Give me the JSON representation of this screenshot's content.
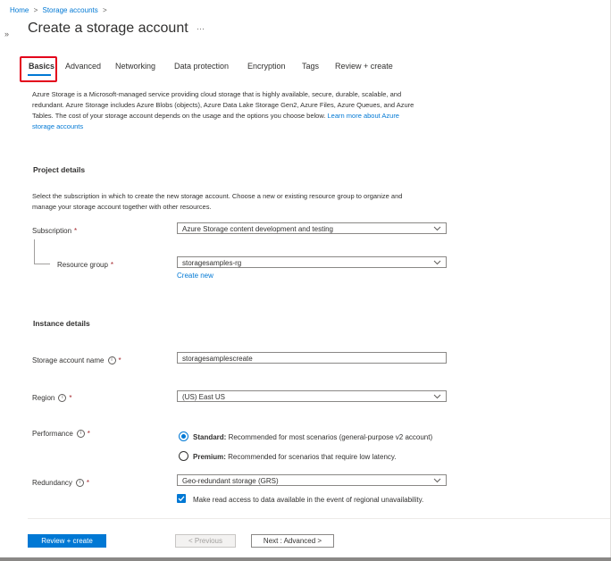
{
  "breadcrumb": {
    "home": "Home",
    "separator": ">",
    "storage_accounts": "Storage accounts",
    "trailing_separator": ">"
  },
  "collapse_glyph": "»",
  "page": {
    "title": "Create a storage account",
    "more": "···"
  },
  "tabs": [
    {
      "label": "Basics",
      "selected": true
    },
    {
      "label": "Advanced"
    },
    {
      "label": "Networking"
    },
    {
      "label": "Data protection"
    },
    {
      "label": "Encryption"
    },
    {
      "label": "Tags"
    },
    {
      "label": "Review + create"
    }
  ],
  "intro": {
    "line1": "Azure Storage is a Microsoft-managed service providing cloud storage that is highly available, secure, durable, scalable, and",
    "line2": "redundant. Azure Storage includes Azure Blobs (objects), Azure Data Lake Storage Gen2, Azure Files, Azure Queues, and Azure",
    "line3": "Tables. The cost of your storage account depends on the usage and the options you choose below.",
    "link_part1": "Learn more about Azure",
    "link_part2": "storage accounts"
  },
  "project": {
    "heading": "Project details",
    "desc_line1": "Select the subscription in which to create the new storage account. Choose a new or existing resource group to organize and",
    "desc_line2": "manage your storage account together with other resources.",
    "subscription_label": "Subscription",
    "subscription_value": "Azure Storage content development and testing",
    "resource_group_label": "Resource group",
    "resource_group_value": "storagesamples-rg",
    "create_new": "Create new"
  },
  "instance": {
    "heading": "Instance details",
    "name_label": "Storage account name",
    "name_value": "storagesamplescreate",
    "region_label": "Region",
    "region_value": "(US) East US",
    "performance_label": "Performance",
    "standard_bold": "Standard:",
    "standard_desc": "Recommended for most scenarios (general-purpose v2 account)",
    "premium_bold": "Premium:",
    "premium_desc": "Recommended for scenarios that require low latency.",
    "redundancy_label": "Redundancy",
    "redundancy_value": "Geo-redundant storage (GRS)",
    "read_access_label": "Make read access to data available in the event of regional unavailability."
  },
  "required_mark": "*",
  "info_glyph": "i",
  "footer": {
    "review_create": "Review + create",
    "previous": "< Previous",
    "next": "Next : Advanced >"
  },
  "colors": {
    "accent": "#0078d4",
    "highlight_box": "#e3001b",
    "required": "#a4262c"
  },
  "icons": [
    "chevron-down-icon",
    "info-icon",
    "checkmark-icon",
    "collapse-sidebar-icon"
  ]
}
